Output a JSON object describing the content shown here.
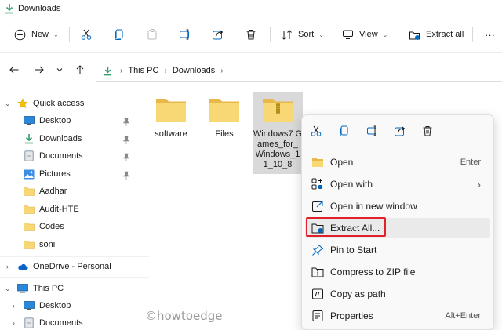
{
  "window": {
    "title": "Downloads"
  },
  "toolbar": {
    "new_label": "New",
    "sort_label": "Sort",
    "view_label": "View",
    "extract_label": "Extract all",
    "more_label": "···"
  },
  "address": {
    "crumbs": [
      "This PC",
      "Downloads"
    ]
  },
  "nav": {
    "quick_access": "Quick access",
    "items": [
      {
        "label": "Desktop",
        "icon": "desktop-icon",
        "pinned": true
      },
      {
        "label": "Downloads",
        "icon": "download-icon",
        "pinned": true
      },
      {
        "label": "Documents",
        "icon": "documents-icon",
        "pinned": true
      },
      {
        "label": "Pictures",
        "icon": "pictures-icon",
        "pinned": true
      },
      {
        "label": "Aadhar",
        "icon": "folder-icon",
        "pinned": false
      },
      {
        "label": "Audit-HTE",
        "icon": "folder-icon",
        "pinned": false
      },
      {
        "label": "Codes",
        "icon": "folder-icon",
        "pinned": false
      },
      {
        "label": "soni",
        "icon": "folder-icon",
        "pinned": false
      }
    ],
    "onedrive": "OneDrive - Personal",
    "this_pc": "This PC",
    "pc_items": [
      {
        "label": "Desktop",
        "icon": "desktop-icon"
      },
      {
        "label": "Documents",
        "icon": "documents-icon"
      }
    ]
  },
  "files": [
    {
      "name": "software",
      "type": "folder"
    },
    {
      "name": "Files",
      "type": "folder"
    },
    {
      "name": "Windows7_Games_for_Windows_11_10_8",
      "display": "Windows7 Games_for_ Windows_1 1_10_8",
      "type": "zip",
      "selected": true
    }
  ],
  "context_menu": {
    "items": [
      {
        "label": "Open",
        "shortcut": "Enter",
        "icon": "folder-open-icon"
      },
      {
        "label": "Open with",
        "shortcut": "",
        "icon": "open-with-icon",
        "submenu": true
      },
      {
        "label": "Open in new window",
        "shortcut": "",
        "icon": "new-window-icon"
      },
      {
        "label": "Extract All...",
        "shortcut": "",
        "icon": "extract-icon",
        "highlighted": true
      },
      {
        "label": "Pin to Start",
        "shortcut": "",
        "icon": "pin-icon"
      },
      {
        "label": "Compress to ZIP file",
        "shortcut": "",
        "icon": "zip-icon"
      },
      {
        "label": "Copy as path",
        "shortcut": "",
        "icon": "copy-path-icon"
      },
      {
        "label": "Properties",
        "shortcut": "Alt+Enter",
        "icon": "properties-icon"
      }
    ]
  },
  "watermark": "©howtoedge",
  "colors": {
    "accent": "#0067c0",
    "folder": "#f8d775",
    "folder_dark": "#e8b84a",
    "highlight_border": "#e0202a",
    "download_green": "#2e9e6a"
  }
}
